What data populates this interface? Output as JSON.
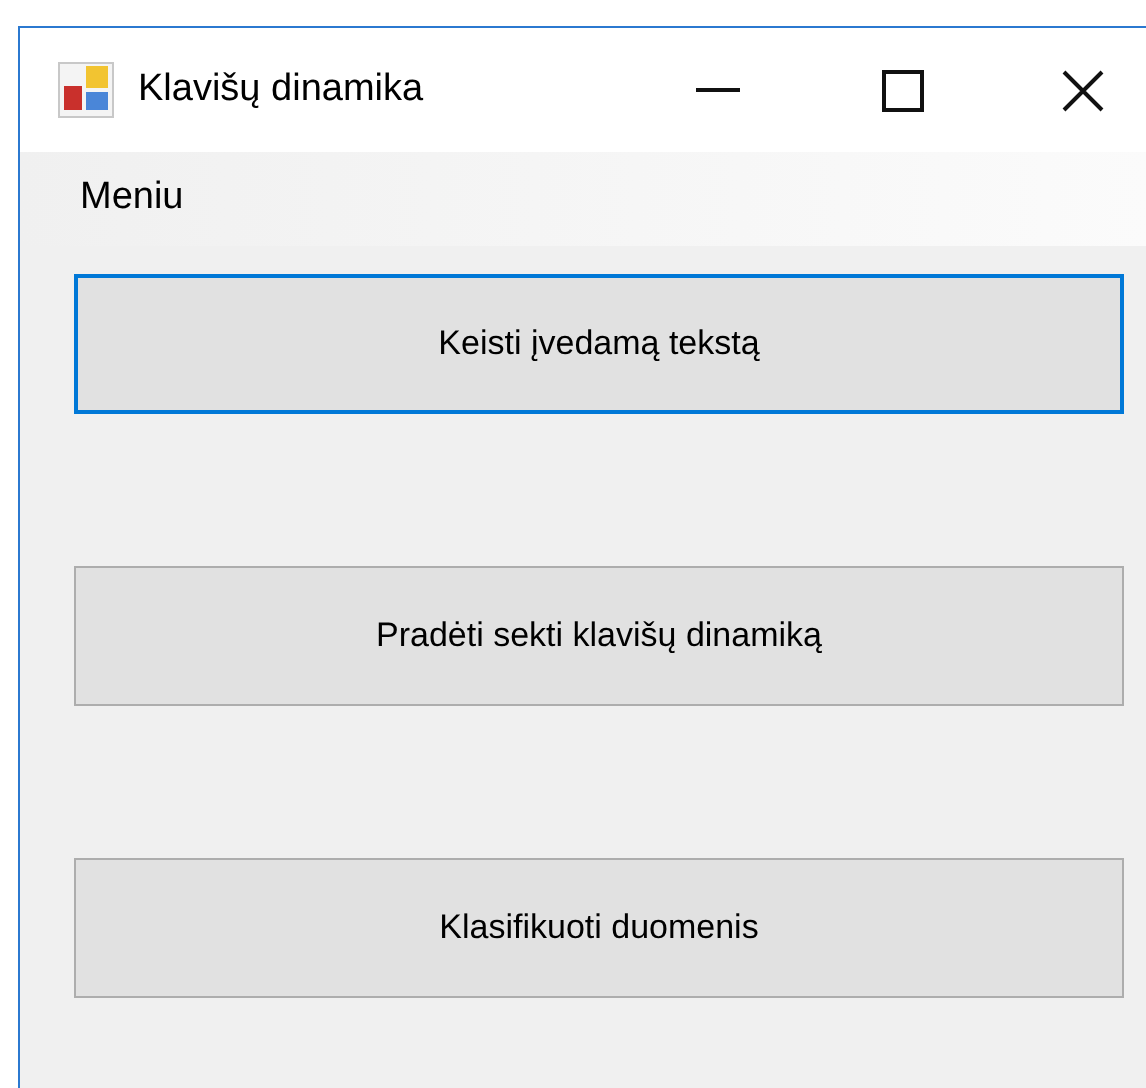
{
  "window": {
    "title": "Klavišų dinamika"
  },
  "menu_bar": {
    "items": [
      "Meniu"
    ]
  },
  "buttons": [
    {
      "label": "Keisti įvedamą tekstą",
      "focused": true
    },
    {
      "label": "Pradėti sekti klavišų dinamiką",
      "focused": false
    },
    {
      "label": "Klasifikuoti duomenis",
      "focused": false
    }
  ]
}
